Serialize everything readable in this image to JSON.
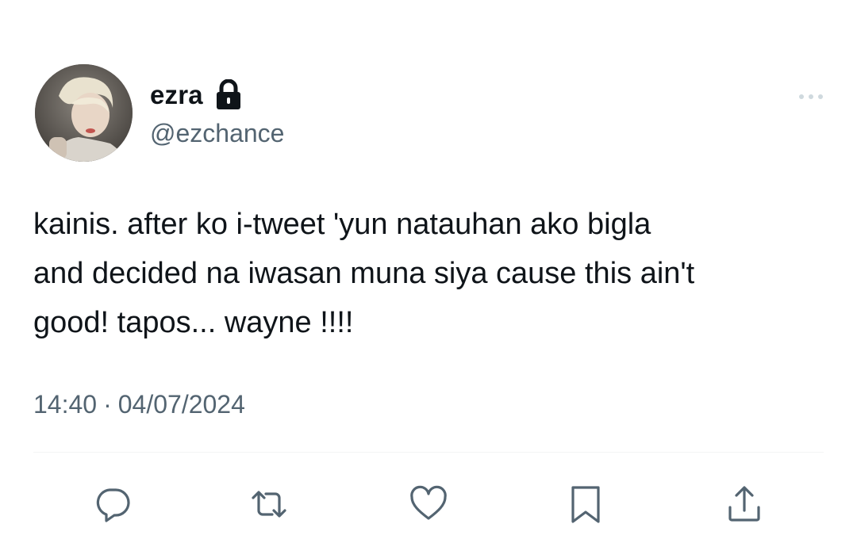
{
  "tweet": {
    "display_name": "ezra",
    "handle": "@ezchance",
    "text": "kainis. after ko i-tweet 'yun natauhan ako bigla\nand decided na iwasan muna siya cause this ain't\ngood! tapos... wayne !!!!",
    "time": "14:40",
    "separator": "·",
    "date": "04/07/2024",
    "protected_icon": "lock-icon",
    "more_icon": "more-horizontal-icon"
  },
  "actions": [
    {
      "name": "reply",
      "icon": "reply-icon"
    },
    {
      "name": "retweet",
      "icon": "retweet-icon"
    },
    {
      "name": "like",
      "icon": "heart-icon"
    },
    {
      "name": "bookmark",
      "icon": "bookmark-icon"
    },
    {
      "name": "share",
      "icon": "share-icon"
    }
  ],
  "colors": {
    "text_primary": "#0f1419",
    "text_secondary": "#536471",
    "icon": "#536471",
    "background": "#ffffff"
  }
}
